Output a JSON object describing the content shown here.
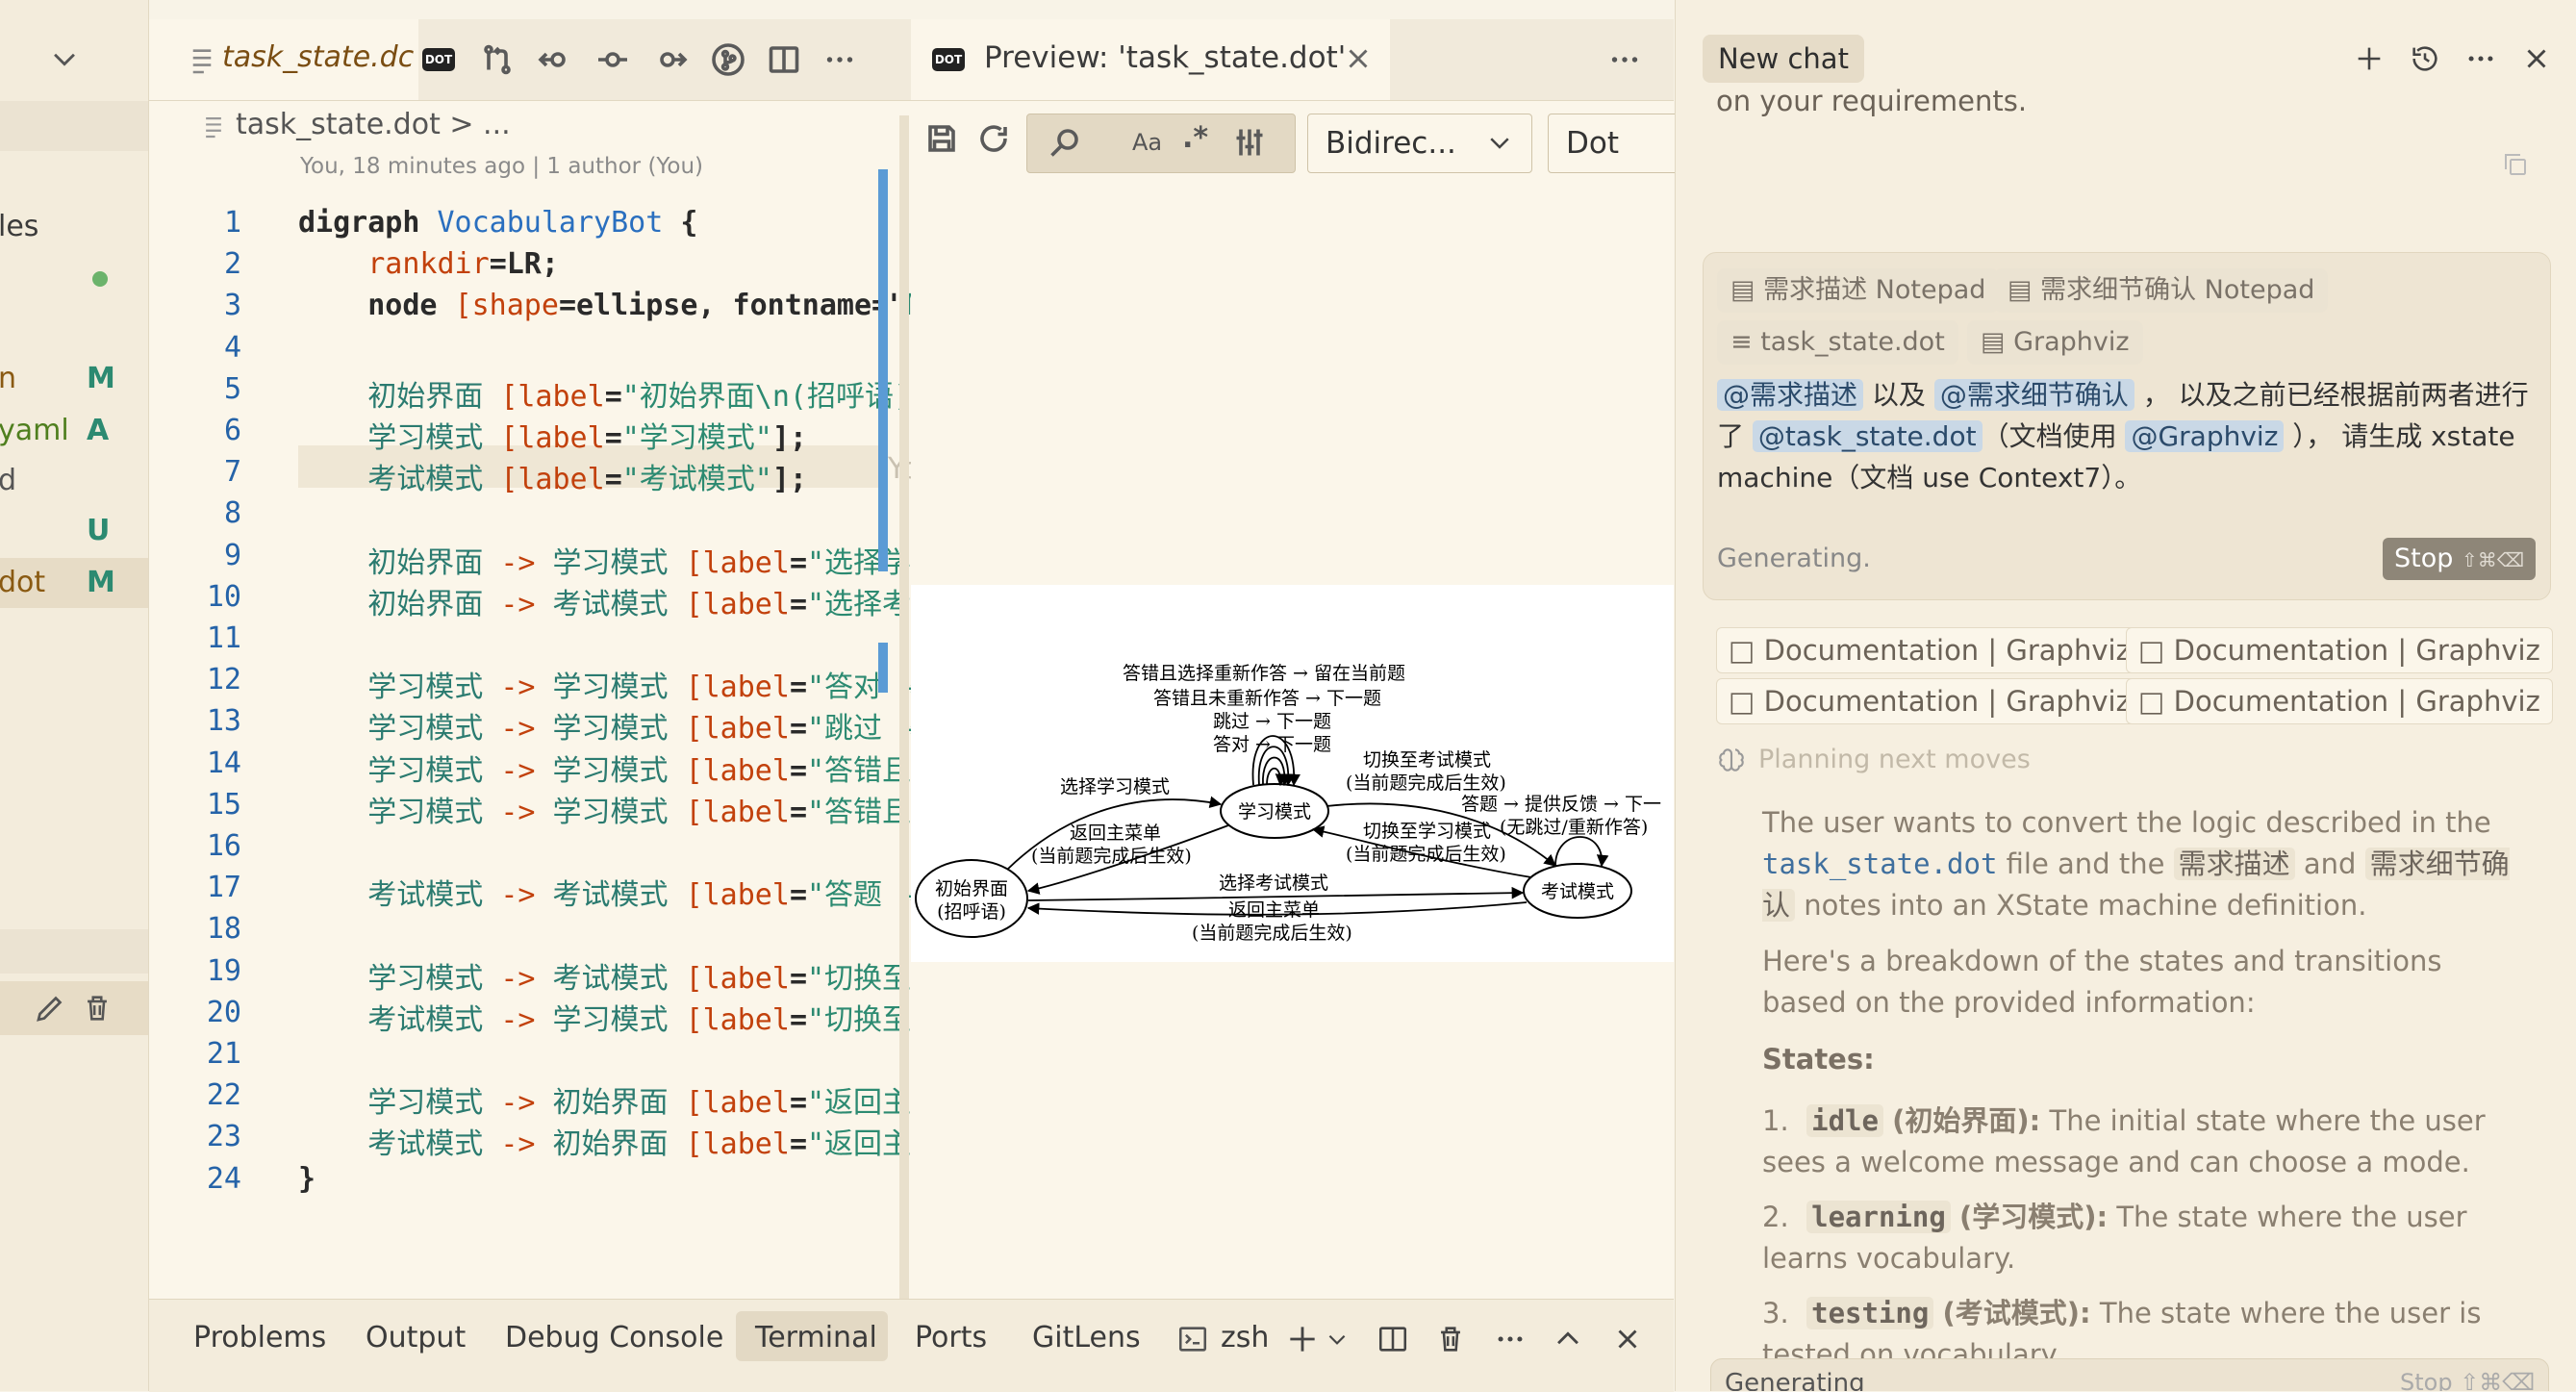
{
  "sidebar": {
    "items": [
      {
        "name": "les",
        "status": ""
      },
      {
        "name": "n",
        "status": "M"
      },
      {
        "name": "yaml",
        "status": "A"
      },
      {
        "name": "d",
        "status": ""
      },
      {
        "name": "",
        "status": "U"
      },
      {
        "name": "dot",
        "status": "M"
      }
    ]
  },
  "editor": {
    "tab_title": "task_state.dc",
    "tab_icon": "DOT",
    "breadcrumb": "task_state.dot > ...",
    "blame": "You, 18 minutes ago | 1 author (You)",
    "inline_blame": "Yo",
    "lines": [
      [
        {
          "t": "digraph ",
          "c": "kw"
        },
        {
          "t": "VocabularyBot ",
          "c": "ty"
        },
        {
          "t": "{",
          "c": "kw"
        }
      ],
      [
        {
          "t": "    rankdir",
          "c": "at"
        },
        {
          "t": "=LR;",
          "c": "kw"
        }
      ],
      [
        {
          "t": "    node ",
          "c": "kw"
        },
        {
          "t": "[shape",
          "c": "at"
        },
        {
          "t": "=ellipse, fontname=\"",
          "c": "kw"
        },
        {
          "t": "Mi",
          "c": "st"
        }
      ],
      [],
      [
        {
          "t": "    初始界面 ",
          "c": "pl"
        },
        {
          "t": "[label",
          "c": "at"
        },
        {
          "t": "=",
          "c": "kw"
        },
        {
          "t": "\"初始界面\\n(招呼语)\"",
          "c": "st"
        },
        {
          "t": "]",
          "c": "kw"
        }
      ],
      [
        {
          "t": "    学习模式 ",
          "c": "pl"
        },
        {
          "t": "[label",
          "c": "at"
        },
        {
          "t": "=",
          "c": "kw"
        },
        {
          "t": "\"学习模式\"",
          "c": "st"
        },
        {
          "t": "];",
          "c": "kw"
        }
      ],
      [
        {
          "t": "    考试模式 ",
          "c": "pl"
        },
        {
          "t": "[label",
          "c": "at"
        },
        {
          "t": "=",
          "c": "kw"
        },
        {
          "t": "\"考试模式\"",
          "c": "st"
        },
        {
          "t": "];",
          "c": "kw"
        }
      ],
      [],
      [
        {
          "t": "    初始界面 ",
          "c": "pl"
        },
        {
          "t": "-> ",
          "c": "op"
        },
        {
          "t": "学习模式 ",
          "c": "pl"
        },
        {
          "t": "[label",
          "c": "at"
        },
        {
          "t": "=",
          "c": "kw"
        },
        {
          "t": "\"选择学习",
          "c": "st"
        }
      ],
      [
        {
          "t": "    初始界面 ",
          "c": "pl"
        },
        {
          "t": "-> ",
          "c": "op"
        },
        {
          "t": "考试模式 ",
          "c": "pl"
        },
        {
          "t": "[label",
          "c": "at"
        },
        {
          "t": "=",
          "c": "kw"
        },
        {
          "t": "\"选择考试",
          "c": "st"
        }
      ],
      [],
      [
        {
          "t": "    学习模式 ",
          "c": "pl"
        },
        {
          "t": "-> ",
          "c": "op"
        },
        {
          "t": "学习模式 ",
          "c": "pl"
        },
        {
          "t": "[label",
          "c": "at"
        },
        {
          "t": "=",
          "c": "kw"
        },
        {
          "t": "\"答对 →",
          "c": "st"
        }
      ],
      [
        {
          "t": "    学习模式 ",
          "c": "pl"
        },
        {
          "t": "-> ",
          "c": "op"
        },
        {
          "t": "学习模式 ",
          "c": "pl"
        },
        {
          "t": "[label",
          "c": "at"
        },
        {
          "t": "=",
          "c": "kw"
        },
        {
          "t": "\"跳过 →",
          "c": "st"
        }
      ],
      [
        {
          "t": "    学习模式 ",
          "c": "pl"
        },
        {
          "t": "-> ",
          "c": "op"
        },
        {
          "t": "学习模式 ",
          "c": "pl"
        },
        {
          "t": "[label",
          "c": "at"
        },
        {
          "t": "=",
          "c": "kw"
        },
        {
          "t": "\"答错且未",
          "c": "st"
        }
      ],
      [
        {
          "t": "    学习模式 ",
          "c": "pl"
        },
        {
          "t": "-> ",
          "c": "op"
        },
        {
          "t": "学习模式 ",
          "c": "pl"
        },
        {
          "t": "[label",
          "c": "at"
        },
        {
          "t": "=",
          "c": "kw"
        },
        {
          "t": "\"答错且选",
          "c": "st"
        }
      ],
      [],
      [
        {
          "t": "    考试模式 ",
          "c": "pl"
        },
        {
          "t": "-> ",
          "c": "op"
        },
        {
          "t": "考试模式 ",
          "c": "pl"
        },
        {
          "t": "[label",
          "c": "at"
        },
        {
          "t": "=",
          "c": "kw"
        },
        {
          "t": "\"答题 →",
          "c": "st"
        }
      ],
      [],
      [
        {
          "t": "    学习模式 ",
          "c": "pl"
        },
        {
          "t": "-> ",
          "c": "op"
        },
        {
          "t": "考试模式 ",
          "c": "pl"
        },
        {
          "t": "[label",
          "c": "at"
        },
        {
          "t": "=",
          "c": "kw"
        },
        {
          "t": "\"切换至考",
          "c": "st"
        }
      ],
      [
        {
          "t": "    考试模式 ",
          "c": "pl"
        },
        {
          "t": "-> ",
          "c": "op"
        },
        {
          "t": "学习模式 ",
          "c": "pl"
        },
        {
          "t": "[label",
          "c": "at"
        },
        {
          "t": "=",
          "c": "kw"
        },
        {
          "t": "\"切换至学",
          "c": "st"
        }
      ],
      [],
      [
        {
          "t": "    学习模式 ",
          "c": "pl"
        },
        {
          "t": "-> ",
          "c": "op"
        },
        {
          "t": "初始界面 ",
          "c": "pl"
        },
        {
          "t": "[label",
          "c": "at"
        },
        {
          "t": "=",
          "c": "kw"
        },
        {
          "t": "\"返回主菜",
          "c": "st"
        }
      ],
      [
        {
          "t": "    考试模式 ",
          "c": "pl"
        },
        {
          "t": "-> ",
          "c": "op"
        },
        {
          "t": "初始界面 ",
          "c": "pl"
        },
        {
          "t": "[label",
          "c": "at"
        },
        {
          "t": "=",
          "c": "kw"
        },
        {
          "t": "\"返回主菜",
          "c": "st"
        }
      ],
      [
        {
          "t": "}",
          "c": "kw"
        }
      ]
    ]
  },
  "preview": {
    "tab_title": "Preview: 'task_state.dot'",
    "tab_icon": "DOT",
    "direction_select": "Bidirec...",
    "engine_select": "Dot",
    "case_label": "Aa",
    "regex_label": ".*",
    "graph": {
      "node_initial": [
        "初始界面",
        "(招呼语)"
      ],
      "node_learn": "学习模式",
      "node_test": "考试模式",
      "self_learn": [
        "答错且选择重新作答 → 留在当前题",
        "答错且未重新作答 → 下一题",
        "跳过 → 下一题",
        "答对 → 下一题"
      ],
      "e_init_learn": "选择学习模式",
      "e_learn_init": [
        "返回主菜单",
        "(当前题完成后生效)"
      ],
      "e_init_test": "选择考试模式",
      "e_test_init": [
        "返回主菜单",
        "(当前题完成后生效)"
      ],
      "e_learn_test": [
        "切换至考试模式",
        "(当前题完成后生效)"
      ],
      "e_test_learn": [
        "切换至学习模式",
        "(当前题完成后生效)"
      ],
      "self_test": [
        "答题 → 提供反馈 → 下一",
        "(无跳过/重新作答)"
      ]
    }
  },
  "panel": {
    "tabs": [
      "Problems",
      "Output",
      "Debug Console",
      "Terminal",
      "Ports",
      "GitLens"
    ],
    "active_tab": "Terminal",
    "shell": "zsh"
  },
  "chat": {
    "title": "New chat",
    "top_text": "on your requirements.",
    "chips": [
      "需求描述 Notepad",
      "需求细节确认 Notepad",
      "task_state.dot",
      "Graphviz"
    ],
    "prompt": {
      "m1": "@需求描述",
      "t1": " 以及 ",
      "m2": "@需求细节确认",
      "t2": " ， 以及之前已经根据前两者进行了 ",
      "m3": "@task_state.dot",
      "t3": "（文档使用 ",
      "m4": "@Graphviz",
      "t4": " ）， 请生成 xstate machine（文档 use Context7）。"
    },
    "generating": "Generating.",
    "stop_label": "Stop",
    "stop_shortcut": "⇧⌘⌫",
    "docs": [
      "Documentation | Graphviz",
      "Documentation | Graphviz",
      "Documentation | Graphviz",
      "Documentation | Graphviz"
    ],
    "planning": "Planning next moves",
    "para1_a": "The user wants to convert the logic described in the ",
    "para1_file": "task_state.dot",
    "para1_b": " file and the ",
    "para1_n1": "需求描述",
    "para1_c": " and ",
    "para1_n2": "需求细节确认",
    "para1_d": " notes into an XState machine definition.",
    "para2": "Here's a breakdown of the states and transitions based on the provided information:",
    "states_heading": "States:",
    "states": [
      {
        "num": "1.",
        "code": "idle",
        "name": "(初始界面):",
        "desc": " The initial state where the user sees a welcome message and can choose a mode."
      },
      {
        "num": "2.",
        "code": "learning",
        "name": "(学习模式):",
        "desc": " The state where the user learns vocabulary."
      },
      {
        "num": "3.",
        "code": "testing",
        "name": "(考试模式):",
        "desc": " The state where the user is tested on vocabulary."
      }
    ],
    "footer_generating": "Generating",
    "footer_stop": "Stop ⇧⌘⌫"
  }
}
